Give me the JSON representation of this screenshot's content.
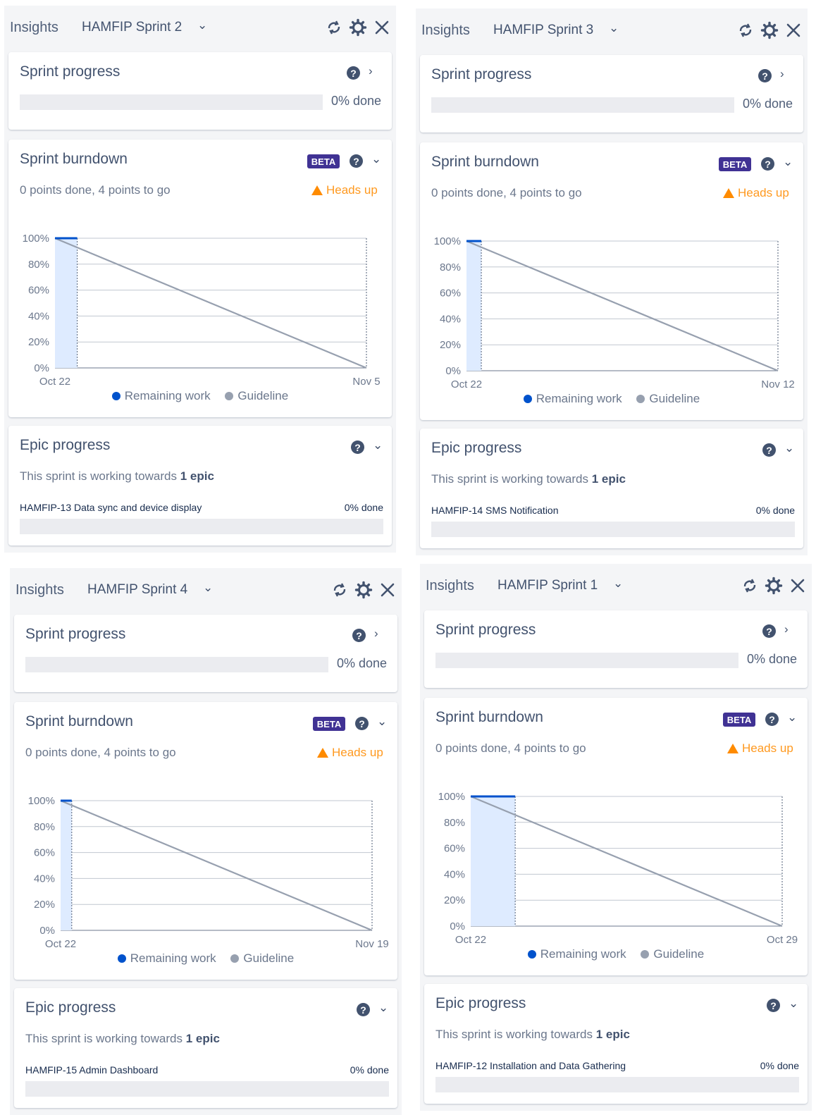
{
  "colors": {
    "remaining": "#0052cc",
    "guideline": "#97a0af",
    "beta": "#403294",
    "heads_up": "#ff991f",
    "scope_fill": "#deebff"
  },
  "icons": [
    "refresh-icon",
    "gear-icon",
    "close-icon",
    "help-icon",
    "chevron-right-icon",
    "chevron-down-icon",
    "warning-icon"
  ],
  "panels": [
    {
      "insights": "Insights",
      "sprint": "HAMFIP Sprint 2",
      "progress": {
        "title": "Sprint progress",
        "value": "0% done",
        "fraction": 0
      },
      "burndown": {
        "title": "Sprint burndown",
        "beta": "BETA",
        "summary": "0 points done, 4 points to go",
        "heads_up": "Heads up",
        "legend": [
          "Remaining work",
          "Guideline"
        ]
      },
      "epic": {
        "title": "Epic progress",
        "towards_prefix": "This sprint is working towards",
        "towards_count": "1 epic",
        "name": "HAMFIP-13 Data sync and device display",
        "value": "0% done",
        "fraction": 0
      }
    },
    {
      "insights": "Insights",
      "sprint": "HAMFIP Sprint 3",
      "progress": {
        "title": "Sprint progress",
        "value": "0% done",
        "fraction": 0
      },
      "burndown": {
        "title": "Sprint burndown",
        "beta": "BETA",
        "summary": "0 points done, 4 points to go",
        "heads_up": "Heads up",
        "legend": [
          "Remaining work",
          "Guideline"
        ]
      },
      "epic": {
        "title": "Epic progress",
        "towards_prefix": "This sprint is working towards",
        "towards_count": "1 epic",
        "name": "HAMFIP-14 SMS Notification",
        "value": "0% done",
        "fraction": 0
      }
    },
    {
      "insights": "Insights",
      "sprint": "HAMFIP Sprint 4",
      "progress": {
        "title": "Sprint progress",
        "value": "0% done",
        "fraction": 0
      },
      "burndown": {
        "title": "Sprint burndown",
        "beta": "BETA",
        "summary": "0 points done, 4 points to go",
        "heads_up": "Heads up",
        "legend": [
          "Remaining work",
          "Guideline"
        ]
      },
      "epic": {
        "title": "Epic progress",
        "towards_prefix": "This sprint is working towards",
        "towards_count": "1 epic",
        "name": "HAMFIP-15 Admin Dashboard",
        "value": "0% done",
        "fraction": 0
      }
    },
    {
      "insights": "Insights",
      "sprint": "HAMFIP Sprint 1",
      "progress": {
        "title": "Sprint progress",
        "value": "0% done",
        "fraction": 0
      },
      "burndown": {
        "title": "Sprint burndown",
        "beta": "BETA",
        "summary": "0 points done, 4 points to go",
        "heads_up": "Heads up",
        "legend": [
          "Remaining work",
          "Guideline"
        ]
      },
      "epic": {
        "title": "Epic progress",
        "towards_prefix": "This sprint is working towards",
        "towards_count": "1 epic",
        "name": "HAMFIP-12 Installation and Data Gathering",
        "value": "0% done",
        "fraction": 0
      }
    }
  ],
  "chart_data": [
    {
      "type": "line",
      "yticks": [
        "100%",
        "80%",
        "60%",
        "40%",
        "20%",
        "0%"
      ],
      "ylim": [
        0,
        100
      ],
      "xlim": [
        "Oct 22",
        "Nov 5"
      ],
      "xticks": [
        "Oct 22",
        "Nov 5"
      ],
      "series": [
        {
          "name": "Remaining work",
          "x": [
            "Oct 22",
            "Oct 23"
          ],
          "y": [
            100,
            100
          ]
        },
        {
          "name": "Guideline",
          "x": [
            "Oct 22",
            "Nov 5"
          ],
          "y": [
            100,
            0
          ]
        }
      ]
    },
    {
      "type": "line",
      "yticks": [
        "100%",
        "80%",
        "60%",
        "40%",
        "20%",
        "0%"
      ],
      "ylim": [
        0,
        100
      ],
      "xlim": [
        "Oct 22",
        "Nov 12"
      ],
      "xticks": [
        "Oct 22",
        "Nov 12"
      ],
      "series": [
        {
          "name": "Remaining work",
          "x": [
            "Oct 22",
            "Oct 23"
          ],
          "y": [
            100,
            100
          ]
        },
        {
          "name": "Guideline",
          "x": [
            "Oct 22",
            "Nov 12"
          ],
          "y": [
            100,
            0
          ]
        }
      ]
    },
    {
      "type": "line",
      "yticks": [
        "100%",
        "80%",
        "60%",
        "40%",
        "20%",
        "0%"
      ],
      "ylim": [
        0,
        100
      ],
      "xlim": [
        "Oct 22",
        "Nov 19"
      ],
      "xticks": [
        "Oct 22",
        "Nov 19"
      ],
      "series": [
        {
          "name": "Remaining work",
          "x": [
            "Oct 22",
            "Oct 23"
          ],
          "y": [
            100,
            100
          ]
        },
        {
          "name": "Guideline",
          "x": [
            "Oct 22",
            "Nov 19"
          ],
          "y": [
            100,
            0
          ]
        }
      ]
    },
    {
      "type": "line",
      "yticks": [
        "100%",
        "80%",
        "60%",
        "40%",
        "20%",
        "0%"
      ],
      "ylim": [
        0,
        100
      ],
      "xlim": [
        "Oct 22",
        "Oct 29"
      ],
      "xticks": [
        "Oct 22",
        "Oct 29"
      ],
      "series": [
        {
          "name": "Remaining work",
          "x": [
            "Oct 22",
            "Oct 23"
          ],
          "y": [
            100,
            100
          ]
        },
        {
          "name": "Guideline",
          "x": [
            "Oct 22",
            "Oct 29"
          ],
          "y": [
            100,
            0
          ]
        }
      ]
    }
  ]
}
